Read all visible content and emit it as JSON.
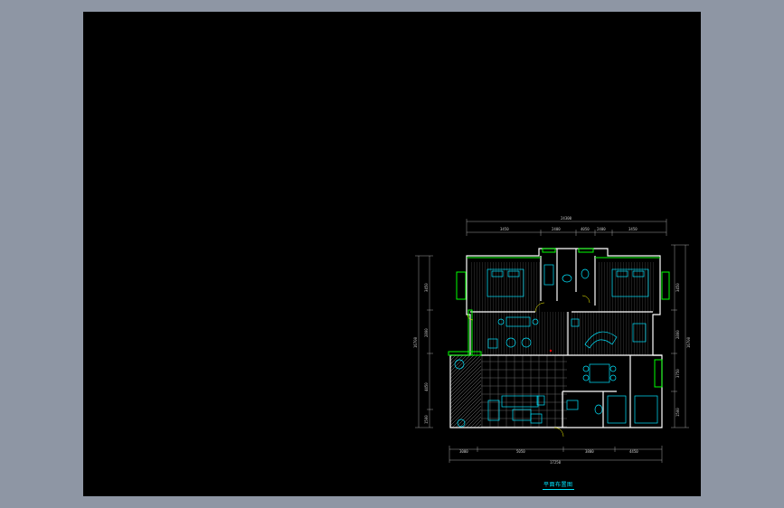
{
  "app": {
    "background": "#8e96a4",
    "viewport_color": "#000000"
  },
  "colors": {
    "wall": "#ffffff",
    "window": "#00ff00",
    "furniture": "#00e5ff",
    "floor": "#9a9a9a",
    "dimension": "#c8c8c8",
    "door_swing": "#ffff00",
    "marker": "#ff0000"
  },
  "plan": {
    "title": "平面布置图",
    "dims_top": [
      "3450",
      "2400",
      "4050",
      "2400",
      "3450"
    ],
    "dims_top_total": "24300",
    "dims_bottom": [
      "3000",
      "5050",
      "3800",
      "4450"
    ],
    "dims_bottom_total": "17250",
    "dims_left": [
      "3450",
      "2800",
      "4450",
      "1500"
    ],
    "dims_left_total": "16700",
    "dims_right": [
      "3450",
      "2800",
      "3750",
      "1500"
    ],
    "dims_right_total": "16700"
  }
}
